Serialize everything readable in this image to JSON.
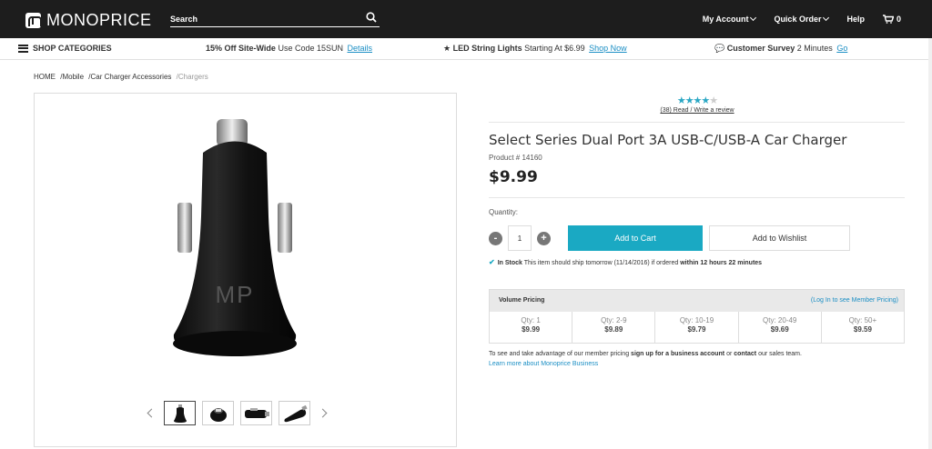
{
  "header": {
    "logo_text": "MONOPRICE",
    "search_placeholder": "Search",
    "my_account": "My Account",
    "quick_order": "Quick Order",
    "help": "Help",
    "cart_count": "0"
  },
  "promobar": {
    "shop_categories": "SHOP CATEGORIES",
    "promo1_bold": "15% Off Site-Wide",
    "promo1_text": " Use Code 15SUN",
    "promo1_link": "Details",
    "promo2_bold": "LED String Lights",
    "promo2_text": " Starting At $6.99",
    "promo2_link": "Shop Now",
    "promo3_bold": "Customer Survey",
    "promo3_text": " 2 Minutes",
    "promo3_link": "Go"
  },
  "breadcrumb": {
    "items": [
      "HOME",
      "/Mobile",
      "/Car Charger Accessories",
      "/Chargers"
    ]
  },
  "product": {
    "rating_stars": 4,
    "rating_text": "(38) Read / Write a review",
    "title": "Select Series Dual Port 3A USB-C/USB-A Car Charger",
    "product_number": "Product # 14160",
    "price": "$9.99",
    "quantity_label": "Quantity:",
    "quantity_value": "1",
    "add_to_cart": "Add to Cart",
    "add_to_wishlist": "Add to Wishlist",
    "stock_status": "In Stock",
    "stock_text": " This item should ship tomorrow (11/14/2016) if ordered ",
    "stock_bold": "within 12 hours 22 minutes",
    "image_logo": "MP"
  },
  "volume_pricing": {
    "title": "Volume Pricing",
    "login_link": "(Log In to see Member Pricing)",
    "tiers": [
      {
        "qty": "Qty: 1",
        "price": "$9.99"
      },
      {
        "qty": "Qty: 2-9",
        "price": "$9.89"
      },
      {
        "qty": "Qty: 10-19",
        "price": "$9.79"
      },
      {
        "qty": "Qty: 20-49",
        "price": "$9.69"
      },
      {
        "qty": "Qty: 50+",
        "price": "$9.59"
      }
    ]
  },
  "member": {
    "text1": "To see and take advantage of our member pricing ",
    "bold1": "sign up for a business account",
    "text2": " or ",
    "bold2": "contact",
    "text3": " our sales team.",
    "link": "Learn more about Monoprice Business"
  },
  "colors": {
    "accent": "#1aa9c3",
    "topbar": "#1d1d1d",
    "link": "#1a8ec4"
  }
}
